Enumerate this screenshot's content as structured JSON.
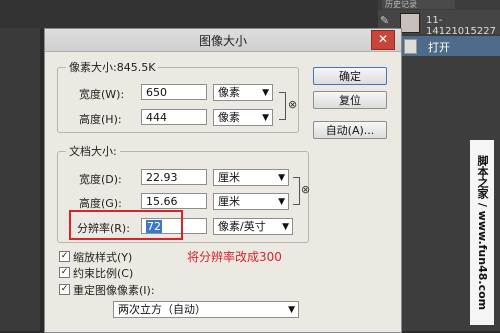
{
  "history_panel": {
    "tab_label": "历史记录",
    "snapshot_label": "11-14121015227",
    "row_label": "打开"
  },
  "watermark": {
    "text": "脚本之家 www.jb51.net",
    "vertical": "脚本之家 / www.fun48.com"
  },
  "dialog": {
    "title": "图像大小",
    "close_label": "✕",
    "pixel_dimensions": {
      "legend": "像素大小:845.5K",
      "width_label": "宽度(W):",
      "width_value": "650",
      "width_unit": "像素",
      "height_label": "高度(H):",
      "height_value": "444",
      "height_unit": "像素"
    },
    "document_size": {
      "legend": "文档大小:",
      "width_label": "宽度(D):",
      "width_value": "22.93",
      "width_unit": "厘米",
      "height_label": "高度(G):",
      "height_value": "15.66",
      "height_unit": "厘米",
      "resolution_label": "分辨率(R):",
      "resolution_value": "72",
      "resolution_unit": "像素/英寸"
    },
    "buttons": {
      "ok": "确定",
      "reset": "复位",
      "auto": "自动(A)..."
    },
    "options": {
      "scale_styles": "缩放样式(Y)",
      "constrain": "约束比例(C)",
      "resample": "重定图像像素(I):",
      "resample_method": "两次立方（自动）",
      "checked_mark": "✓"
    },
    "annotation": "将分辨率改成300",
    "arrow_glyph": "▼",
    "chain_glyph": "⊗"
  }
}
